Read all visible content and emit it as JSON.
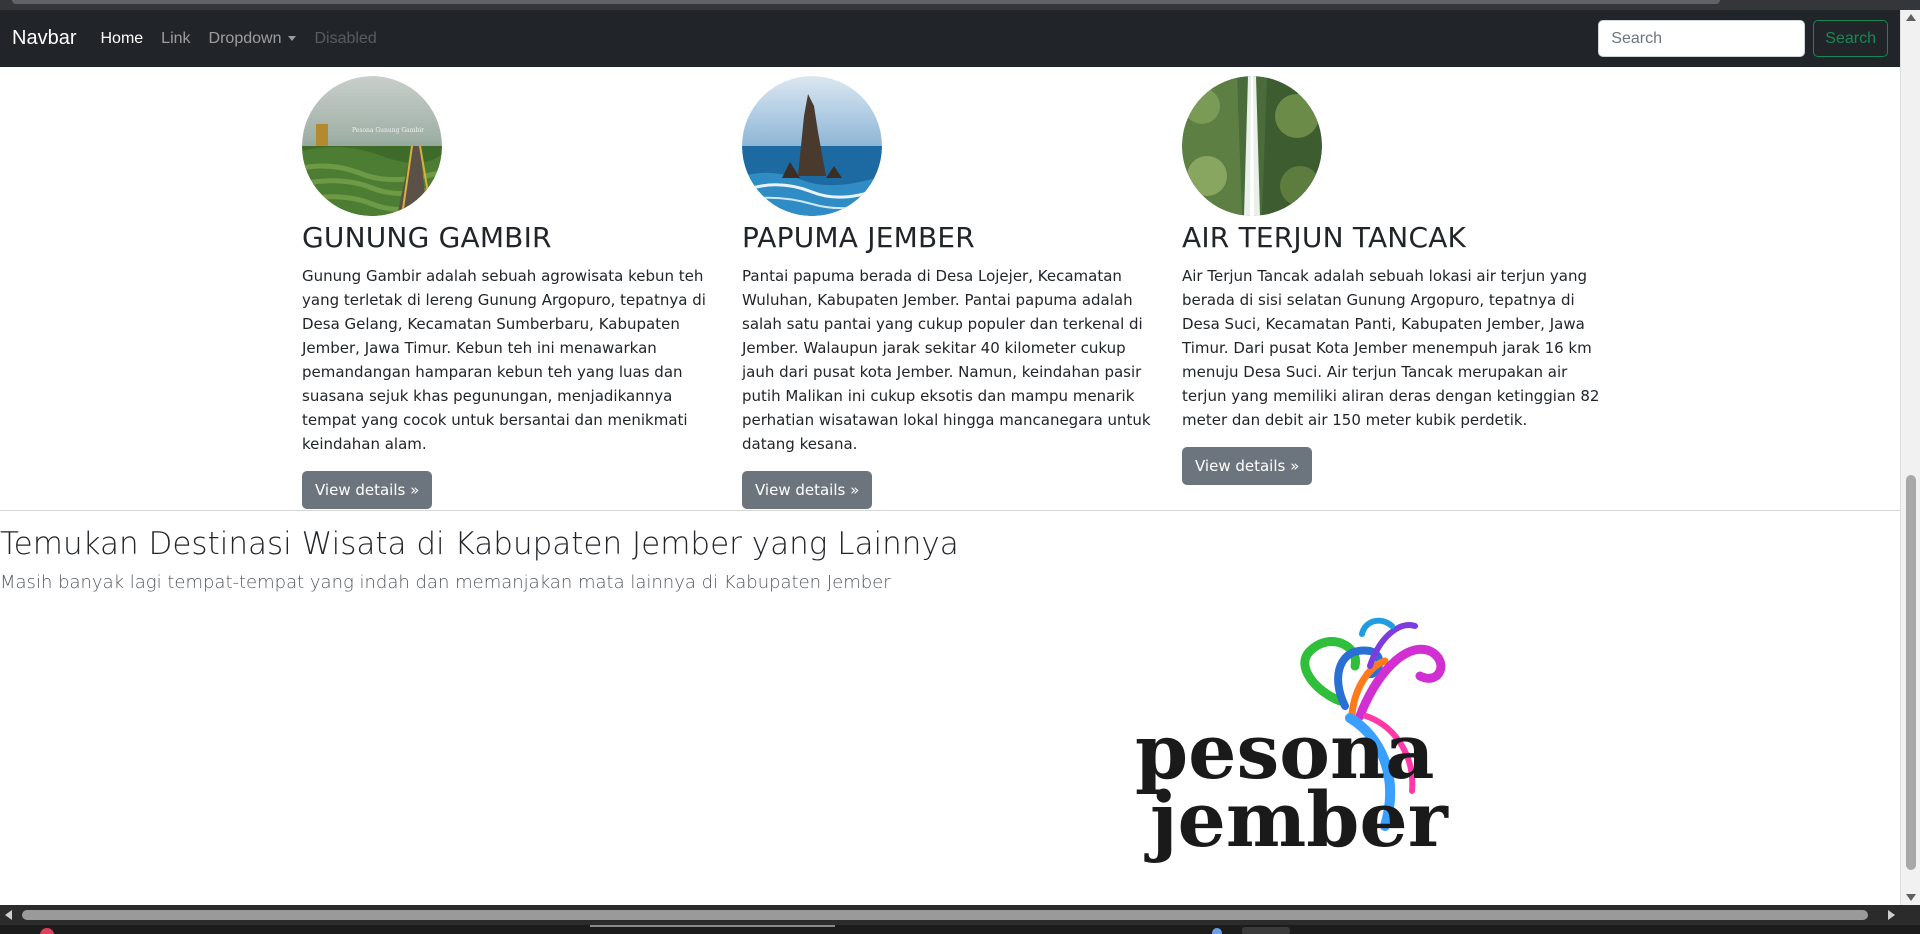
{
  "navbar": {
    "brand": "Navbar",
    "links": [
      "Home",
      "Link",
      "Dropdown",
      "Disabled"
    ],
    "search_placeholder": "Search",
    "search_button": "Search"
  },
  "destinations": [
    {
      "title": "GUNUNG GAMBIR",
      "description": "Gunung Gambir adalah sebuah agrowisata kebun teh yang terletak di lereng Gunung Argopuro, tepatnya di Desa Gelang, Kecamatan Sumberbaru, Kabupaten Jember, Jawa Timur. Kebun teh ini menawarkan pemandangan hamparan kebun teh yang luas dan suasana sejuk khas pegunungan, menjadikannya tempat yang cocok untuk bersantai dan menikmati keindahan alam.",
      "button": "View details »",
      "image_caption": "Pesona Gunung Gambir"
    },
    {
      "title": "PAPUMA JEMBER",
      "description": "Pantai papuma berada di Desa Lojejer, Kecamatan Wuluhan, Kabupaten Jember. Pantai papuma adalah salah satu pantai yang cukup populer dan terkenal di Jember. Walaupun jarak sekitar 40 kilometer cukup jauh dari pusat kota Jember. Namun, keindahan pasir putih Malikan ini cukup eksotis dan mampu menarik perhatian wisatawan lokal hingga mancanegara untuk datang kesana.",
      "button": "View details »"
    },
    {
      "title": "AIR TERJUN TANCAK",
      "description": "Air Terjun Tancak adalah sebuah lokasi air terjun yang berada di sisi selatan Gunung Argopuro, tepatnya di Desa Suci, Kecamatan Panti, Kabupaten Jember, Jawa Timur. Dari pusat Kota Jember menempuh jarak 16 km menuju Desa Suci. Air terjun Tancak merupakan air terjun yang memiliki aliran deras dengan ketinggian 82 meter dan debit air 150 meter kubik perdetik.",
      "button": "View details »"
    }
  ],
  "section": {
    "title": "Temukan Destinasi Wisata di Kabupaten Jember yang Lainnya",
    "subtitle": "Masih banyak lagi tempat-tempat yang indah dan memanjakan mata lainnya di Kabupaten Jember"
  },
  "logo": {
    "line1": "pesona",
    "line2": "jember"
  },
  "colors": {
    "navbar_bg": "#212529",
    "search_accent": "#198754",
    "button_bg": "#6c757d"
  }
}
